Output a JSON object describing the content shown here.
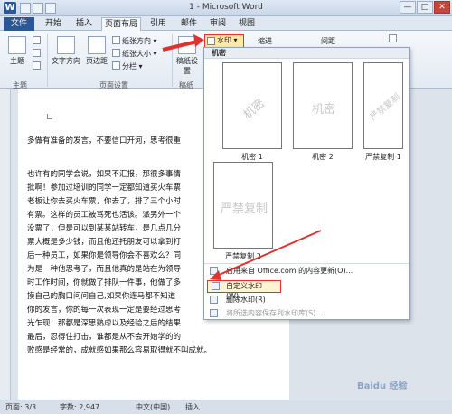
{
  "window": {
    "title": "1 - Microsoft Word",
    "app_icon": "W",
    "buttons": [
      "—",
      "□",
      "✕"
    ]
  },
  "tabs": [
    {
      "label": "文件"
    },
    {
      "label": "开始"
    },
    {
      "label": "插入"
    },
    {
      "label": "页面布局"
    },
    {
      "label": "引用"
    },
    {
      "label": "邮件"
    },
    {
      "label": "审阅"
    },
    {
      "label": "视图"
    }
  ],
  "ribbon": {
    "themes_label": "主题",
    "text_direction": "文字方向",
    "margins": "页边距",
    "orientation": "纸张方向",
    "size": "纸张大小",
    "columns": "分栏",
    "manuscript": "稿纸设置",
    "group_theme": "主题",
    "group_page_setup": "页面设置",
    "group_manuscript": "稿纸",
    "watermark": "水印",
    "indent": "缩进",
    "spacing": "间距"
  },
  "document": {
    "lines": [
      "多做有准备的发言，不要信口开河，思考很重",
      "也许有的同学会说，如果不汇报，那很多事情",
      "批啊！参加过培训的同学一定都知道买火车票",
      "老板让你去买火车票，你去了，排了三个小时",
      "有票。这样的员工被骂死也活该。派另外一个",
      "没票了，但是可以到某某站转车，是几点几分",
      "票大概是多少钱，而且他还托朋友可以拿到打",
      "后一种员工，如果你是领导你会不喜欢么？同",
      "为是一种他思考了，而且他真的是站在为领导",
      "时工作时间，你就做了排队一件事，他做了多",
      "摸自己的胸口问问自己,如果你连马都不知道",
      "你的发言，你的每一次表现一定是要经过思考",
      "光乍现！那都是深思熟虑以及经验之后的结果",
      "最后，忍得住打击，谁都是从不会开始学的的",
      "败感是经常的，成就感如果那么容易取得就不叫成就。"
    ]
  },
  "watermark_menu": {
    "header": "机密",
    "thumbnails": [
      {
        "mark": "机密",
        "label": "机密 1",
        "style": "diagonal"
      },
      {
        "mark": "机密",
        "label": "机密 2",
        "style": "flat"
      },
      {
        "mark": "严禁复制",
        "label": "严禁复制 1",
        "style": "diagonal"
      },
      {
        "mark": "严禁复制",
        "label": "严禁复制 2",
        "style": "flat"
      }
    ],
    "items": [
      {
        "label": "启用来自 Office.com 的内容更新(O)...",
        "enabled": true
      },
      {
        "label": "自定义水印(W)...",
        "enabled": true,
        "highlighted": true
      },
      {
        "label": "删除水印(R)",
        "enabled": true
      },
      {
        "label": "将所选内容保存到水印库(S)...",
        "enabled": false
      }
    ]
  },
  "status": {
    "page": "页面: 3/3",
    "words": "字数: 2,947",
    "lang": "中文(中国)",
    "mode": "插入"
  },
  "watermark_text": "Baidu 经验",
  "colors": {
    "accent": "#2b5797",
    "highlight_border": "#e0312f",
    "arrow": "#e0312f"
  }
}
